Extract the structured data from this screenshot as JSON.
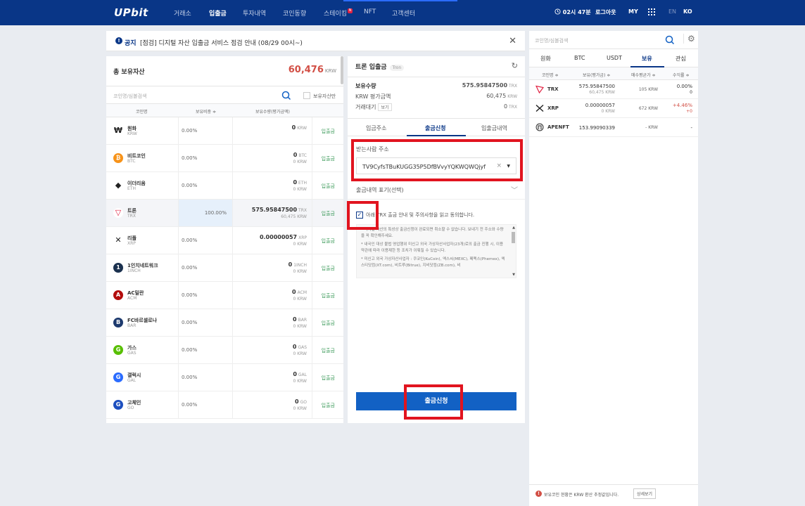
{
  "header": {
    "logo": "UPbit",
    "nav": [
      "거래소",
      "입출금",
      "투자내역",
      "코인동향",
      "스테이킹",
      "NFT",
      "고객센터"
    ],
    "new_badge": "N",
    "timer": "02시 47분",
    "logout": "로그아웃",
    "my": "MY",
    "lang_en": "EN",
    "lang_ko": "KO"
  },
  "notice": {
    "icon": "!",
    "label": "공지",
    "text": "[점검] 디지털 자산 입출금 서비스 점검 안내 (08/29 00시~)"
  },
  "assets": {
    "title": "총 보유자산",
    "amount": "60,476",
    "unit": "KRW",
    "search_placeholder": "코인명/심볼검색",
    "only_held_label": "보유자산만",
    "columns": [
      "코인명",
      "보유비중 ≑",
      "보유수량(평가금액)"
    ],
    "rows": [
      {
        "icon": "₩",
        "color": "#ffffff",
        "name": "원화",
        "sym": "KRW",
        "pct": "0.00%",
        "amount": "0",
        "unit": "KRW",
        "krw": "",
        "dep": "입출금"
      },
      {
        "icon": "₿",
        "color": "#f7931a",
        "name": "비트코인",
        "sym": "BTC",
        "pct": "0.00%",
        "amount": "0",
        "unit": "BTC",
        "krw": "0 KRW",
        "dep": "입출금"
      },
      {
        "icon": "◆",
        "color": "#ffffff",
        "name": "이더리움",
        "sym": "ETH",
        "pct": "0.00%",
        "amount": "0",
        "unit": "ETH",
        "krw": "0 KRW",
        "dep": "입출금"
      },
      {
        "icon": "▽",
        "color": "#ffffff",
        "name": "트론",
        "sym": "TRX",
        "pct": "100.00%",
        "amount": "575.95847500",
        "unit": "TRX",
        "krw": "60,475 KRW",
        "dep": "입출금"
      },
      {
        "icon": "✕",
        "color": "#ffffff",
        "name": "리플",
        "sym": "XRP",
        "pct": "0.00%",
        "amount": "0.00000057",
        "unit": "XRP",
        "krw": "0 KRW",
        "dep": "입출금"
      },
      {
        "icon": "1",
        "color": "#1b314f",
        "name": "1인치네트워크",
        "sym": "1INCH",
        "pct": "0.00%",
        "amount": "0",
        "unit": "1INCH",
        "krw": "0 KRW",
        "dep": "입출금"
      },
      {
        "icon": "A",
        "color": "#b30d0d",
        "name": "AC밀란",
        "sym": "ACM",
        "pct": "0.00%",
        "amount": "0",
        "unit": "ACM",
        "krw": "0 KRW",
        "dep": "입출금"
      },
      {
        "icon": "B",
        "color": "#1e3a6e",
        "name": "FC바르셀로나",
        "sym": "BAR",
        "pct": "0.00%",
        "amount": "0",
        "unit": "BAR",
        "krw": "0 KRW",
        "dep": "입출금"
      },
      {
        "icon": "G",
        "color": "#58bf00",
        "name": "가스",
        "sym": "GAS",
        "pct": "0.00%",
        "amount": "0",
        "unit": "GAS",
        "krw": "0 KRW",
        "dep": "입출금"
      },
      {
        "icon": "G",
        "color": "#2b6cff",
        "name": "갤럭시",
        "sym": "GAL",
        "pct": "0.00%",
        "amount": "0",
        "unit": "GAL",
        "krw": "0 KRW",
        "dep": "입출금"
      },
      {
        "icon": "G",
        "color": "#1d4fbf",
        "name": "고체인",
        "sym": "GO",
        "pct": "0.00%",
        "amount": "0",
        "unit": "GO",
        "krw": "0 KRW",
        "dep": "입출금"
      }
    ]
  },
  "deposit": {
    "title": "트론 입출금",
    "tag": "Tron",
    "refresh_icon": "↻",
    "balance_label": "보유수량",
    "balance_value": "575.95847500",
    "balance_unit": "TRX",
    "krw_label": "KRW 평가금액",
    "krw_value": "60,475",
    "krw_unit": "KRW",
    "pending_label": "거래대기",
    "pending_btn": "보기",
    "pending_value": "0",
    "pending_unit": "TRX",
    "tabs": [
      "입금주소",
      "출금신청",
      "입출금내역"
    ],
    "recv_label": "받는사람 주소",
    "address": "TV9CyfsTBuKUGG35P5DfBVvyYQKWQWQjyf",
    "clear_icon": "×",
    "dropdown_icon": "▼",
    "memo_label": "출금내역 표기(선택)",
    "memo_chevron": "﹀",
    "agree_check": "✓",
    "agree_text": "아래 TRX 출금 안내 및 주의사항을 읽고 동의합니다.",
    "terms": [
      "* 디지털 자산의 특성상 출금신청이 완료되면 취소할 수 없습니다. 보내기 전 주소와 수량을 꼭 확인해주세요.",
      "* 내국인 대상 불법 영업행위 미신고 외국 가상자산사업자(23개)로의 출금 진행 시, 이용약관에 따라 이용제한 등 조치가 이뤄질 수 있습니다.",
      "* 미신고 외국 가상자산사업자 : 쿠코인(KuCoin), 엑스씨(MEXC), 페멕스(Phemex), 엑스티닷컴(XT.com), 비트루(Bitrue), 지비닷컴(ZB.com), 비"
    ],
    "scroll_up": "▲",
    "scroll_down": "▼",
    "submit_label": "출금신청"
  },
  "side": {
    "search_placeholder": "코인명/심볼검색",
    "gear_icon": "⚙",
    "tabs": [
      "원화",
      "BTC",
      "USDT",
      "보유",
      "관심"
    ],
    "columns": [
      "코인명 ≑",
      "보유(평가금) ≑",
      "매수평균가 ≑",
      "수익률 ≑"
    ],
    "rows": [
      {
        "name": "TRX",
        "hold": "575.95847500",
        "hold_krw": "60,475 KRW",
        "avg": "105 KRW",
        "rate": "0.00%",
        "rate2": "0",
        "up": false
      },
      {
        "name": "XRP",
        "hold": "0.00000057",
        "hold_krw": "0 KRW",
        "avg": "672 KRW",
        "rate": "+4.46%",
        "rate2": "+0",
        "up": true
      },
      {
        "name": "APENFT",
        "hold": "153.99090339",
        "hold_krw": "",
        "avg": "- KRW",
        "rate": "-",
        "rate2": "",
        "up": false
      }
    ],
    "footer_icon": "!",
    "footer_text": "보유코인 현황은 KRW 환산 추정값입니다.",
    "footer_btn": "상세보기"
  },
  "colors": {
    "brand": "#093687",
    "primary_button": "#1261c4",
    "highlight": "#e1141f",
    "up": "#d24f45"
  }
}
